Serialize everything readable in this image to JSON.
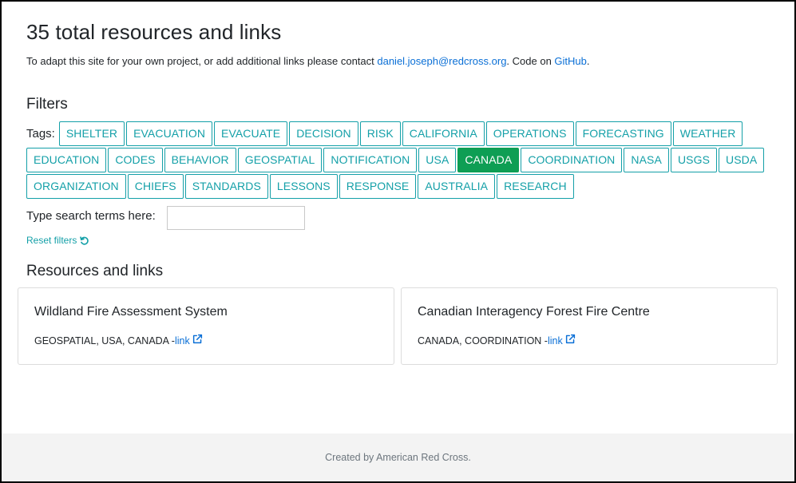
{
  "header": {
    "title": "35 total resources and links",
    "intro_prefix": "To adapt this site for your own project, or add additional links please contact ",
    "contact_email": "daniel.joseph@redcross.org",
    "intro_middle": ". Code on ",
    "github_label": "GitHub",
    "intro_suffix": "."
  },
  "filters": {
    "title": "Filters",
    "tags_label": "Tags:",
    "tags": [
      "SHELTER",
      "EVACUATION",
      "EVACUATE",
      "DECISION",
      "RISK",
      "CALIFORNIA",
      "OPERATIONS",
      "FORECASTING",
      "WEATHER",
      "EDUCATION",
      "CODES",
      "BEHAVIOR",
      "GEOSPATIAL",
      "NOTIFICATION",
      "USA",
      "CANADA",
      "COORDINATION",
      "NASA",
      "USGS",
      "USDA",
      "ORGANIZATION",
      "CHIEFS",
      "STANDARDS",
      "LESSONS",
      "RESPONSE",
      "AUSTRALIA",
      "RESEARCH"
    ],
    "active_tag": "CANADA",
    "search_label": "Type search terms here:",
    "search_value": "",
    "search_placeholder": "",
    "reset_label": "Reset filters"
  },
  "resources": {
    "title": "Resources and links",
    "cards": [
      {
        "title": "Wildland Fire Assessment System",
        "tags_text": "GEOSPATIAL, USA, CANADA - ",
        "link_label": "link"
      },
      {
        "title": "Canadian Interagency Forest Fire Centre",
        "tags_text": "CANADA, COORDINATION - ",
        "link_label": "link"
      }
    ]
  },
  "footer": {
    "text": "Created by American Red Cross."
  },
  "colors": {
    "tag_outline": "#14a0a8",
    "tag_active": "#0e9e54",
    "link": "#0a6fd6",
    "footer_bg": "#f3f3f3"
  },
  "icons": {
    "reset": "undo-icon",
    "external_link": "external-link-icon"
  }
}
